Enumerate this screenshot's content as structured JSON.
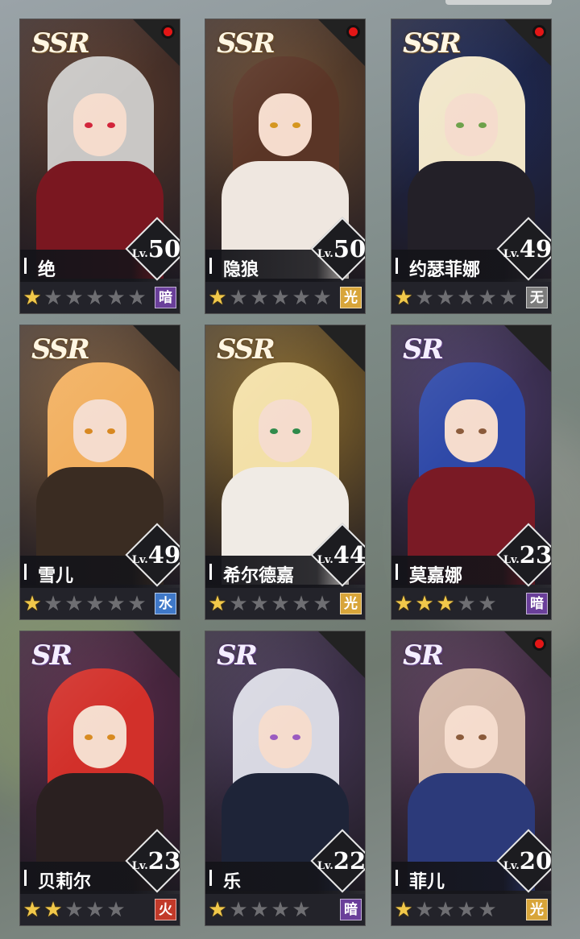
{
  "colors": {
    "star_filled": "#f1c84a",
    "star_empty": "#6e6e72",
    "notification_dot": "#e31616",
    "elements": {
      "暗": "#6a3f9a",
      "光": "#d8a53a",
      "无": "#7c7c7c",
      "水": "#3f78c8",
      "火": "#c23a2a"
    }
  },
  "characters": [
    {
      "name": "绝",
      "rarity": "SSR",
      "lv_prefix": "Lv.",
      "level": "50",
      "stars": 1,
      "max_stars": 6,
      "element": "暗",
      "element_color": "#6a3f9a",
      "has_notification": true,
      "palette": {
        "bg": "#5a3a2a",
        "hair": "#c9c7c5",
        "outfit": "#7a1720",
        "eye": "#d2243a"
      }
    },
    {
      "name": "隐狼",
      "rarity": "SSR",
      "lv_prefix": "Lv.",
      "level": "50",
      "stars": 1,
      "max_stars": 6,
      "element": "光",
      "element_color": "#d8a53a",
      "has_notification": true,
      "palette": {
        "bg": "#6b4a2e",
        "hair": "#5a3526",
        "outfit": "#efe7e0",
        "eye": "#d5961f"
      }
    },
    {
      "name": "约瑟菲娜",
      "rarity": "SSR",
      "lv_prefix": "Lv.",
      "level": "49",
      "stars": 1,
      "max_stars": 6,
      "element": "无",
      "element_color": "#7c7c7c",
      "has_notification": true,
      "palette": {
        "bg": "#1d2a5a",
        "hair": "#f1e6c9",
        "outfit": "#232028",
        "eye": "#6da14a"
      }
    },
    {
      "name": "雪儿",
      "rarity": "SSR",
      "lv_prefix": "Lv.",
      "level": "49",
      "stars": 1,
      "max_stars": 6,
      "element": "水",
      "element_color": "#3f78c8",
      "has_notification": false,
      "palette": {
        "bg": "#7a5a3a",
        "hair": "#f2b060",
        "outfit": "#3a2c22",
        "eye": "#d88820"
      }
    },
    {
      "name": "希尔德嘉",
      "rarity": "SSR",
      "lv_prefix": "Lv.",
      "level": "44",
      "stars": 1,
      "max_stars": 6,
      "element": "光",
      "element_color": "#d8a53a",
      "has_notification": false,
      "palette": {
        "bg": "#8a6a2a",
        "hair": "#f3e0a8",
        "outfit": "#f0ebe5",
        "eye": "#2f8a4a"
      }
    },
    {
      "name": "莫嘉娜",
      "rarity": "SR",
      "lv_prefix": "Lv.",
      "level": "23",
      "stars": 3,
      "max_stars": 5,
      "element": "暗",
      "element_color": "#6a3f9a",
      "has_notification": false,
      "palette": {
        "bg": "#4a3a6a",
        "hair": "#2f49a8",
        "outfit": "#7a1a25",
        "eye": "#8a5a3a"
      }
    },
    {
      "name": "贝莉尔",
      "rarity": "SR",
      "lv_prefix": "Lv.",
      "level": "23",
      "stars": 2,
      "max_stars": 5,
      "element": "火",
      "element_color": "#c23a2a",
      "has_notification": false,
      "palette": {
        "bg": "#5a2a4a",
        "hair": "#d2302a",
        "outfit": "#2a2020",
        "eye": "#d88a20"
      }
    },
    {
      "name": "乐",
      "rarity": "SR",
      "lv_prefix": "Lv.",
      "level": "22",
      "stars": 1,
      "max_stars": 5,
      "element": "暗",
      "element_color": "#6a3f9a",
      "has_notification": false,
      "palette": {
        "bg": "#4a3a5a",
        "hair": "#d8d8e2",
        "outfit": "#1e2438",
        "eye": "#9a5ac0"
      }
    },
    {
      "name": "菲儿",
      "rarity": "SR",
      "lv_prefix": "Lv.",
      "level": "20",
      "stars": 1,
      "max_stars": 5,
      "element": "光",
      "element_color": "#d8a53a",
      "has_notification": true,
      "palette": {
        "bg": "#5a3a5a",
        "hair": "#d4b8a8",
        "outfit": "#2c3a7a",
        "eye": "#8a5a3a"
      }
    }
  ]
}
